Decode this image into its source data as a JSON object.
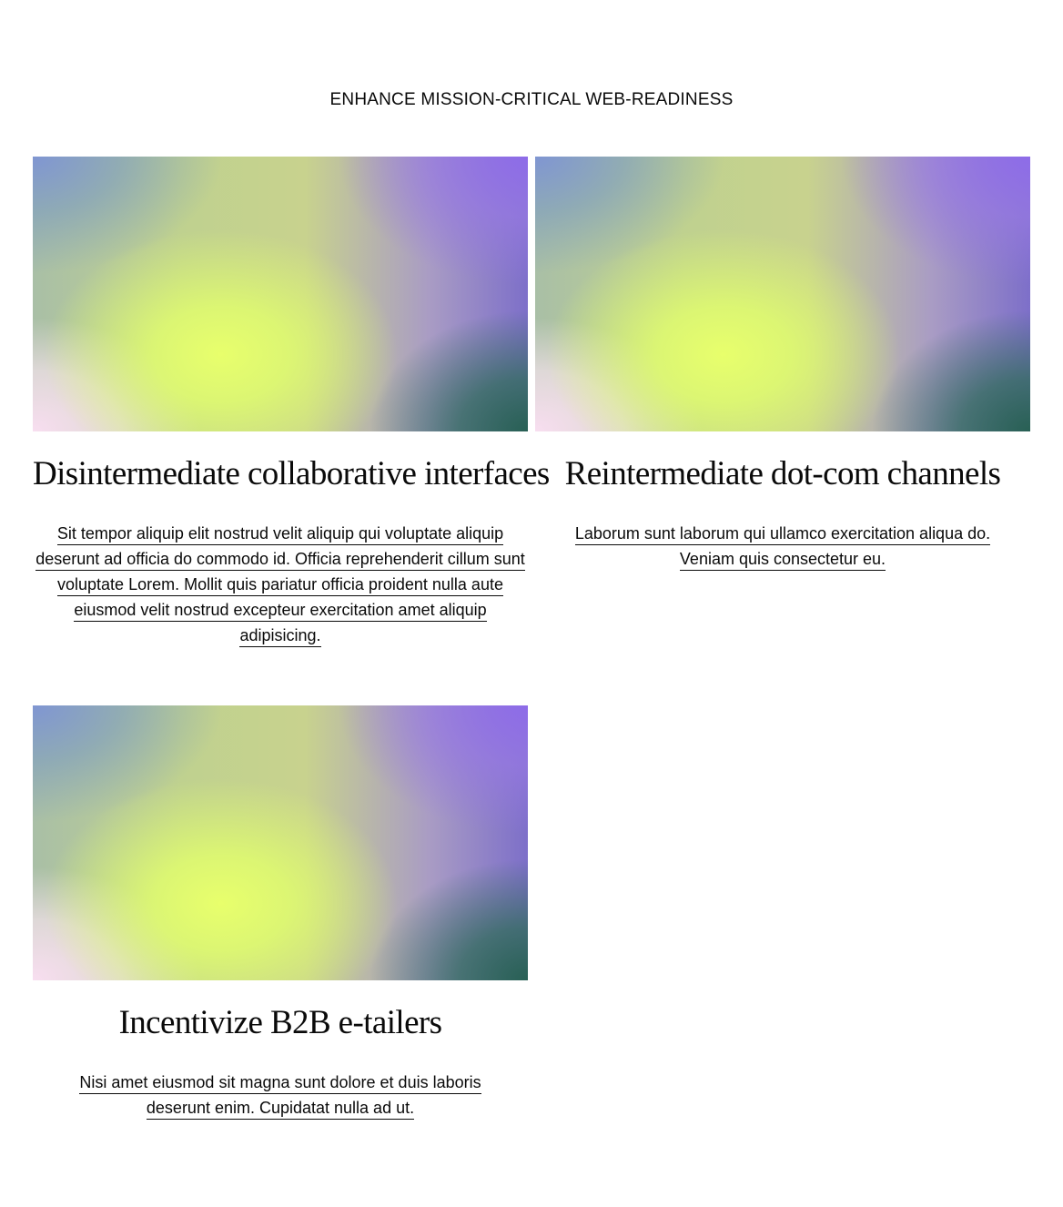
{
  "section": {
    "title": "ENHANCE MISSION-CRITICAL WEB-READINESS"
  },
  "cards": [
    {
      "title": "Disintermediate collaborative interfaces",
      "description": "Sit tempor aliquip elit nostrud velit aliquip qui voluptate aliquip deserunt ad officia do commodo id. Officia reprehenderit cillum sunt voluptate Lorem. Mollit quis pariatur officia proident nulla aute eiusmod velit nostrud excepteur exercitation amet aliquip adipisicing."
    },
    {
      "title": "Reintermediate dot-com channels",
      "description": "Laborum sunt laborum qui ullamco exercitation aliqua do. Veniam quis consectetur eu."
    },
    {
      "title": "Incentivize B2B e-tailers",
      "description": "Nisi amet eiusmod sit magna sunt dolore et duis laboris deserunt enim. Cupidatat nulla ad ut."
    }
  ],
  "colors": {
    "text": "#0a0a0a",
    "background": "#ffffff",
    "gradient_center": "#e8ff6c",
    "gradient_top_right": "#8e6ce8",
    "gradient_bottom_right": "#286054",
    "gradient_bottom_left": "#f8def0",
    "gradient_top_left": "#8096d2"
  }
}
